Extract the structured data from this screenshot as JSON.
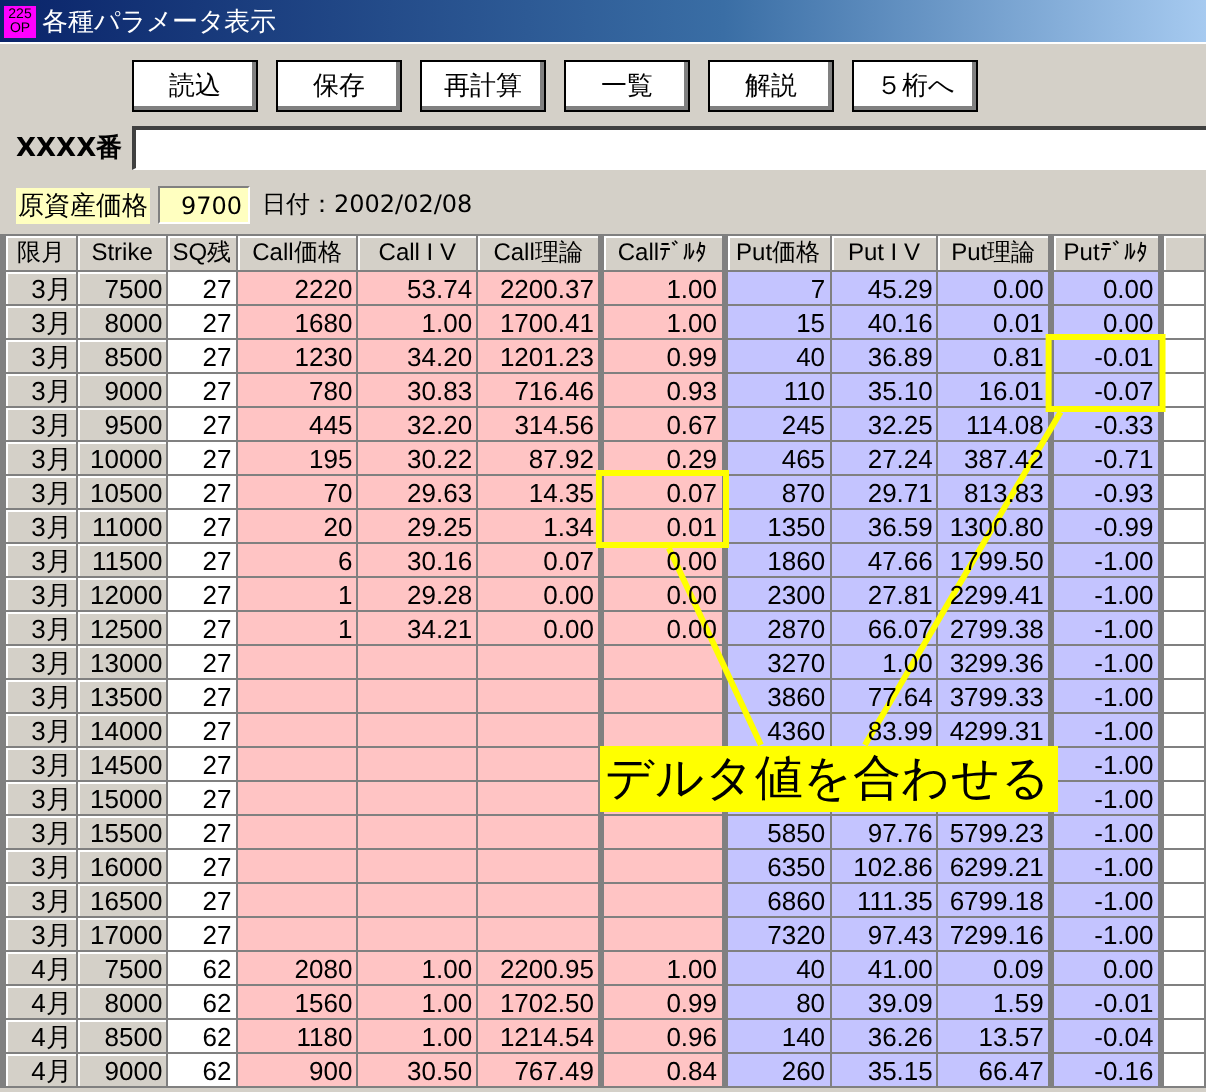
{
  "window": {
    "title": "各種パラメータ表示",
    "icon_text": [
      "225",
      "OP"
    ]
  },
  "buttons": [
    "読込",
    "保存",
    "再計算",
    "一覧",
    "解説",
    "５桁へ"
  ],
  "code_field": {
    "label": "XXXX番"
  },
  "underlying": {
    "label": "原資産価格",
    "value": "9700",
    "date": "日付：2002/02/08"
  },
  "table": {
    "columns": [
      {
        "label": "限月",
        "kind": "key",
        "separator": false
      },
      {
        "label": "Strike",
        "kind": "key",
        "separator": false
      },
      {
        "label": "SQ残",
        "kind": "sq",
        "separator": false
      },
      {
        "label": "Call価格",
        "kind": "call",
        "separator": false
      },
      {
        "label": "Call I V",
        "kind": "call",
        "separator": false
      },
      {
        "label": "Call理論",
        "kind": "call",
        "separator": false
      },
      {
        "label": "Callﾃﾞﾙﾀ",
        "kind": "call",
        "separator": true
      },
      {
        "label": "Put価格",
        "kind": "put",
        "separator": true
      },
      {
        "label": "Put I V",
        "kind": "put",
        "separator": false
      },
      {
        "label": "Put理論",
        "kind": "put",
        "separator": false
      },
      {
        "label": "Putﾃﾞﾙﾀ",
        "kind": "put",
        "separator": true
      }
    ],
    "rows": [
      {
        "cells": [
          "3月",
          "7500",
          "27",
          "2220",
          "53.74",
          "2200.37",
          "1.00",
          "7",
          "45.29",
          "0.00",
          "0.00"
        ],
        "call_delta_marked": false,
        "put_delta_marked": false
      },
      {
        "cells": [
          "3月",
          "8000",
          "27",
          "1680",
          "1.00",
          "1700.41",
          "1.00",
          "15",
          "40.16",
          "0.01",
          "0.00"
        ],
        "call_delta_marked": false,
        "put_delta_marked": false
      },
      {
        "cells": [
          "3月",
          "8500",
          "27",
          "1230",
          "34.20",
          "1201.23",
          "0.99",
          "40",
          "36.89",
          "0.81",
          "-0.01"
        ],
        "call_delta_marked": false,
        "put_delta_marked": true
      },
      {
        "cells": [
          "3月",
          "9000",
          "27",
          "780",
          "30.83",
          "716.46",
          "0.93",
          "110",
          "35.10",
          "16.01",
          "-0.07"
        ],
        "call_delta_marked": false,
        "put_delta_marked": true
      },
      {
        "cells": [
          "3月",
          "9500",
          "27",
          "445",
          "32.20",
          "314.56",
          "0.67",
          "245",
          "32.25",
          "114.08",
          "-0.33"
        ],
        "call_delta_marked": false,
        "put_delta_marked": false
      },
      {
        "cells": [
          "3月",
          "10000",
          "27",
          "195",
          "30.22",
          "87.92",
          "0.29",
          "465",
          "27.24",
          "387.42",
          "-0.71"
        ],
        "call_delta_marked": false,
        "put_delta_marked": false
      },
      {
        "cells": [
          "3月",
          "10500",
          "27",
          "70",
          "29.63",
          "14.35",
          "0.07",
          "870",
          "29.71",
          "813.83",
          "-0.93"
        ],
        "call_delta_marked": true,
        "put_delta_marked": false
      },
      {
        "cells": [
          "3月",
          "11000",
          "27",
          "20",
          "29.25",
          "1.34",
          "0.01",
          "1350",
          "36.59",
          "1300.80",
          "-0.99"
        ],
        "call_delta_marked": true,
        "put_delta_marked": false
      },
      {
        "cells": [
          "3月",
          "11500",
          "27",
          "6",
          "30.16",
          "0.07",
          "0.00",
          "1860",
          "47.66",
          "1799.50",
          "-1.00"
        ],
        "call_delta_marked": false,
        "put_delta_marked": false
      },
      {
        "cells": [
          "3月",
          "12000",
          "27",
          "1",
          "29.28",
          "0.00",
          "0.00",
          "2300",
          "27.81",
          "2299.41",
          "-1.00"
        ],
        "call_delta_marked": false,
        "put_delta_marked": false
      },
      {
        "cells": [
          "3月",
          "12500",
          "27",
          "1",
          "34.21",
          "0.00",
          "0.00",
          "2870",
          "66.07",
          "2799.38",
          "-1.00"
        ],
        "call_delta_marked": false,
        "put_delta_marked": false
      },
      {
        "cells": [
          "3月",
          "13000",
          "27",
          null,
          null,
          null,
          null,
          "3270",
          "1.00",
          "3299.36",
          "-1.00"
        ],
        "call_delta_marked": false,
        "put_delta_marked": false
      },
      {
        "cells": [
          "3月",
          "13500",
          "27",
          null,
          null,
          null,
          null,
          "3860",
          "77.64",
          "3799.33",
          "-1.00"
        ],
        "call_delta_marked": false,
        "put_delta_marked": false
      },
      {
        "cells": [
          "3月",
          "14000",
          "27",
          null,
          null,
          null,
          null,
          "4360",
          "83.99",
          "4299.31",
          "-1.00"
        ],
        "call_delta_marked": false,
        "put_delta_marked": false
      },
      {
        "cells": [
          "3月",
          "14500",
          "27",
          null,
          null,
          null,
          null,
          null,
          null,
          null,
          "-1.00"
        ],
        "call_delta_marked": false,
        "put_delta_marked": false
      },
      {
        "cells": [
          "3月",
          "15000",
          "27",
          null,
          null,
          null,
          null,
          null,
          null,
          null,
          "-1.00"
        ],
        "call_delta_marked": false,
        "put_delta_marked": false
      },
      {
        "cells": [
          "3月",
          "15500",
          "27",
          null,
          null,
          null,
          null,
          "5850",
          "97.76",
          "5799.23",
          "-1.00"
        ],
        "call_delta_marked": false,
        "put_delta_marked": false
      },
      {
        "cells": [
          "3月",
          "16000",
          "27",
          null,
          null,
          null,
          null,
          "6350",
          "102.86",
          "6299.21",
          "-1.00"
        ],
        "call_delta_marked": false,
        "put_delta_marked": false
      },
      {
        "cells": [
          "3月",
          "16500",
          "27",
          null,
          null,
          null,
          null,
          "6860",
          "111.35",
          "6799.18",
          "-1.00"
        ],
        "call_delta_marked": false,
        "put_delta_marked": false
      },
      {
        "cells": [
          "3月",
          "17000",
          "27",
          null,
          null,
          null,
          null,
          "7320",
          "97.43",
          "7299.16",
          "-1.00"
        ],
        "call_delta_marked": false,
        "put_delta_marked": false
      },
      {
        "cells": [
          "4月",
          "7500",
          "62",
          "2080",
          "1.00",
          "2200.95",
          "1.00",
          "40",
          "41.00",
          "0.09",
          "0.00"
        ],
        "call_delta_marked": false,
        "put_delta_marked": false
      },
      {
        "cells": [
          "4月",
          "8000",
          "62",
          "1560",
          "1.00",
          "1702.50",
          "0.99",
          "80",
          "39.09",
          "1.59",
          "-0.01"
        ],
        "call_delta_marked": false,
        "put_delta_marked": false
      },
      {
        "cells": [
          "4月",
          "8500",
          "62",
          "1180",
          "1.00",
          "1214.54",
          "0.96",
          "140",
          "36.26",
          "13.57",
          "-0.04"
        ],
        "call_delta_marked": false,
        "put_delta_marked": false
      },
      {
        "cells": [
          "4月",
          "9000",
          "62",
          "900",
          "30.50",
          "767.49",
          "0.84",
          "260",
          "35.15",
          "66.47",
          "-0.16"
        ],
        "call_delta_marked": false,
        "put_delta_marked": false
      }
    ]
  },
  "annotation": {
    "text": "デルタ値を合わせる"
  }
}
